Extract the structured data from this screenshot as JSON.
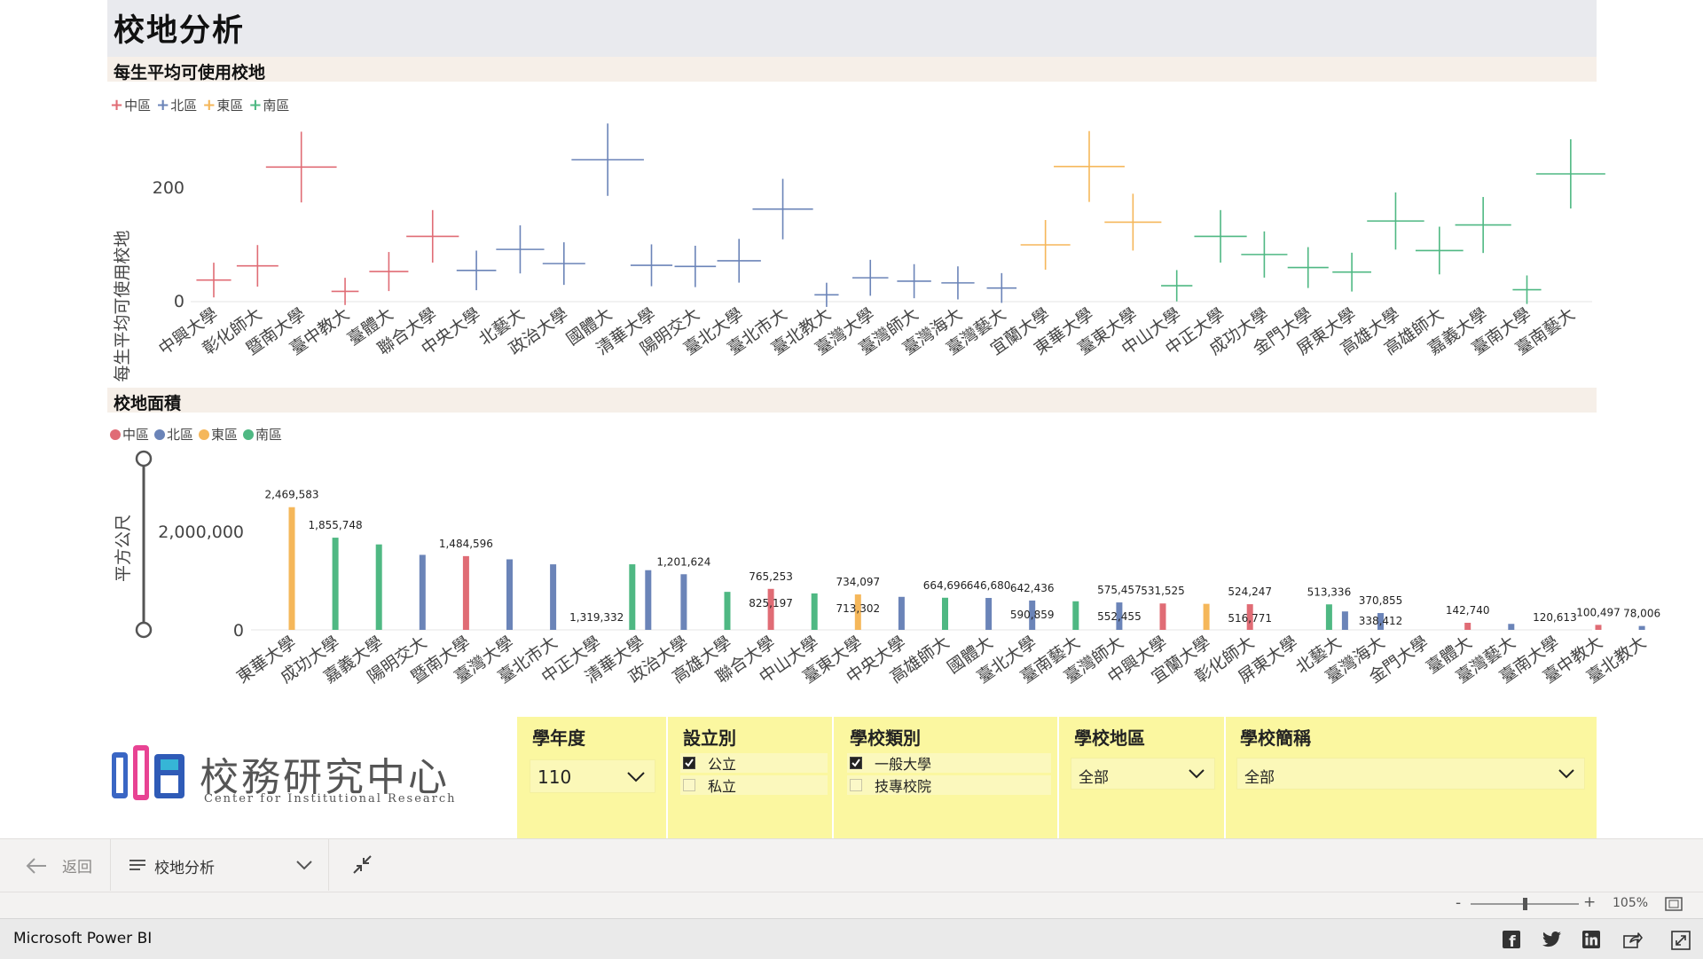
{
  "report": {
    "title": "校地分析"
  },
  "colors": {
    "central": "#e06c75",
    "north": "#6b84b8",
    "east": "#f5b75a",
    "south": "#4fb883"
  },
  "chart1": {
    "section_title": "每生平均可使用校地",
    "legend": [
      "中區",
      "北區",
      "東區",
      "南區"
    ],
    "ylabel": "每生平均可使用校地",
    "yticks": [
      "0",
      "200"
    ]
  },
  "chart2": {
    "section_title": "校地面積",
    "legend": [
      "中區",
      "北區",
      "東區",
      "南區"
    ],
    "ylabel": "平方公尺",
    "yticks": [
      "0",
      "2,000,000"
    ]
  },
  "chart_data": [
    {
      "type": "scatter",
      "title": "每生平均可使用校地",
      "ylabel": "每生平均可使用校地",
      "ylim": [
        0,
        300
      ],
      "legend_position": "top-left",
      "categories": [
        "中興大學",
        "彰化師大",
        "暨南大學",
        "臺中教大",
        "臺體大",
        "聯合大學",
        "中央大學",
        "北藝大",
        "政治大學",
        "國體大",
        "清華大學",
        "陽明交大",
        "臺北大學",
        "臺北市大",
        "臺北教大",
        "臺灣大學",
        "臺灣師大",
        "臺灣海大",
        "臺灣藝大",
        "宜蘭大學",
        "東華大學",
        "臺東大學",
        "中山大學",
        "中正大學",
        "成功大學",
        "金門大學",
        "屏東大學",
        "高雄大學",
        "高雄師大",
        "嘉義大學",
        "臺南大學",
        "臺南藝大"
      ],
      "regions": [
        "中區",
        "中區",
        "中區",
        "中區",
        "中區",
        "中區",
        "北區",
        "北區",
        "北區",
        "北區",
        "北區",
        "北區",
        "北區",
        "北區",
        "北區",
        "北區",
        "北區",
        "北區",
        "北區",
        "東區",
        "東區",
        "東區",
        "南區",
        "南區",
        "南區",
        "南區",
        "南區",
        "南區",
        "南區",
        "南區",
        "南區",
        "南區"
      ],
      "values": [
        38,
        63,
        237,
        18,
        53,
        115,
        55,
        92,
        67,
        250,
        64,
        62,
        72,
        163,
        12,
        42,
        36,
        33,
        24,
        100,
        238,
        140,
        28,
        115,
        83,
        60,
        52,
        142,
        90,
        135,
        21,
        225
      ]
    },
    {
      "type": "bar",
      "title": "校地面積",
      "ylabel": "平方公尺",
      "ylim": [
        0,
        2600000
      ],
      "legend_position": "top-left",
      "categories": [
        "東華大學",
        "成功大學",
        "嘉義大學",
        "陽明交大",
        "暨南大學",
        "臺灣大學",
        "臺北市大",
        "中正大學",
        "清華大學",
        "政治大學",
        "高雄大學",
        "聯合大學",
        "中山大學",
        "臺東大學",
        "中央大學",
        "高雄師大",
        "國體大",
        "臺北大學",
        "臺南藝大",
        "臺灣師大",
        "中興大學",
        "宜蘭大學",
        "彰化師大",
        "屏東大學",
        "北藝大",
        "臺灣海大",
        "金門大學",
        "臺體大",
        "臺灣藝大",
        "臺南大學",
        "臺中教大",
        "臺北教大"
      ],
      "series": [
        {
          "name": "中區",
          "values": [
            null,
            null,
            null,
            null,
            1484596,
            null,
            null,
            null,
            null,
            null,
            null,
            825197,
            null,
            null,
            null,
            null,
            null,
            null,
            null,
            null,
            531525,
            null,
            516771,
            null,
            null,
            null,
            null,
            142740,
            null,
            null,
            100497,
            null
          ]
        },
        {
          "name": "北區",
          "values": [
            null,
            null,
            null,
            1510000,
            null,
            1420000,
            1319332,
            null,
            1201624,
            1120000,
            null,
            null,
            null,
            null,
            664696,
            null,
            642436,
            590859,
            null,
            552455,
            null,
            null,
            null,
            null,
            370855,
            338412,
            null,
            null,
            120613,
            null,
            null,
            78006
          ]
        },
        {
          "name": "東區",
          "values": [
            2469583,
            null,
            null,
            null,
            null,
            null,
            null,
            null,
            null,
            null,
            null,
            null,
            null,
            713302,
            null,
            null,
            null,
            null,
            null,
            null,
            null,
            524247,
            null,
            null,
            null,
            null,
            null,
            null,
            null,
            null,
            null,
            null
          ]
        },
        {
          "name": "南區",
          "values": [
            null,
            1855748,
            1720000,
            null,
            null,
            null,
            null,
            null,
            1320000,
            null,
            765253,
            null,
            734097,
            null,
            null,
            646680,
            null,
            null,
            575457,
            null,
            null,
            null,
            null,
            null,
            513336,
            null,
            null,
            null,
            null,
            null,
            null,
            null
          ]
        }
      ],
      "data_labels": [
        {
          "i": 0,
          "text": "2,469,583"
        },
        {
          "i": 1,
          "text": "1,855,748"
        },
        {
          "i": 4,
          "text": "1,484,596"
        },
        {
          "i": 7,
          "text": "1,319,332"
        },
        {
          "i": 9,
          "text": "1,201,624"
        },
        {
          "i": 11,
          "text": "765,253"
        },
        {
          "i": 11,
          "text": "825,197"
        },
        {
          "i": 13,
          "text": "734,097"
        },
        {
          "i": 13,
          "text": "713,302"
        },
        {
          "i": 15,
          "text": "664,696"
        },
        {
          "i": 16,
          "text": "646,680"
        },
        {
          "i": 17,
          "text": "642,436"
        },
        {
          "i": 17,
          "text": "590,859"
        },
        {
          "i": 19,
          "text": "575,457"
        },
        {
          "i": 19,
          "text": "552,455"
        },
        {
          "i": 20,
          "text": "531,525"
        },
        {
          "i": 22,
          "text": "524,247"
        },
        {
          "i": 22,
          "text": "516,771"
        },
        {
          "i": 24,
          "text": "513,336"
        },
        {
          "i": 25,
          "text": "370,855"
        },
        {
          "i": 25,
          "text": "338,412"
        },
        {
          "i": 27,
          "text": "142,740"
        },
        {
          "i": 29,
          "text": "120,613"
        },
        {
          "i": 30,
          "text": "100,497"
        },
        {
          "i": 31,
          "text": "78,006"
        }
      ]
    }
  ],
  "logo": {
    "cn": "校務研究中心",
    "en": "Center for Institutional Research"
  },
  "filters": {
    "year": {
      "title": "學年度",
      "value": "110"
    },
    "type": {
      "title": "設立別",
      "options": [
        {
          "label": "公立",
          "checked": true
        },
        {
          "label": "私立",
          "checked": false
        }
      ]
    },
    "category": {
      "title": "學校類別",
      "options": [
        {
          "label": "一般大學",
          "checked": true
        },
        {
          "label": "技專校院",
          "checked": false
        }
      ]
    },
    "region": {
      "title": "學校地區",
      "value": "全部"
    },
    "school": {
      "title": "學校簡稱",
      "value": "全部"
    }
  },
  "nav": {
    "back_label": "返回",
    "page_label": "校地分析"
  },
  "status": {
    "zoom": "105%",
    "minus": "-",
    "plus": "+"
  },
  "footer": {
    "brand": "Microsoft Power BI"
  }
}
